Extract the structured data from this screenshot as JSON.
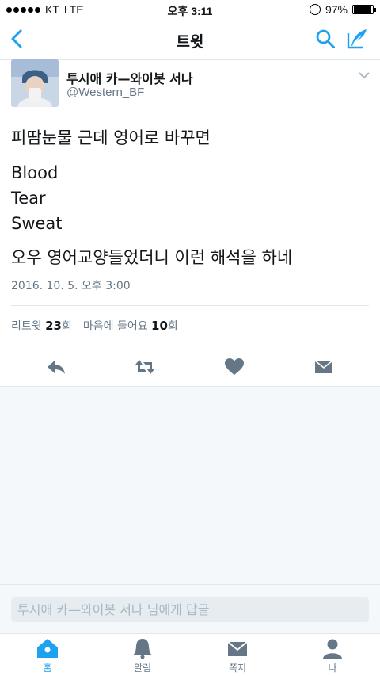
{
  "status_bar": {
    "carrier": "KT",
    "network": "LTE",
    "time": "오후 3:11",
    "battery": "97%",
    "battery_level": 0.97
  },
  "nav": {
    "title": "트윗"
  },
  "tweet": {
    "author_name": "투시애 카—와이봇 서나",
    "handle": "@Western_BF",
    "lines": [
      "피땀눈물 근데 영어로 바꾸면",
      "Blood",
      "Tear",
      "Sweat",
      "오우 영어교양들었더니 이런 해석을 하네"
    ],
    "timestamp": "2016. 10. 5. 오후 3:00",
    "retweets_label": "리트윗",
    "retweets_count": "23",
    "retweets_unit": "회",
    "likes_label": "마음에 들어요",
    "likes_count": "10",
    "likes_unit": "회"
  },
  "reply": {
    "placeholder": "투시애 카—와이봇 서나 님에게 답글"
  },
  "tabs": [
    {
      "label": "홈",
      "icon": "home-icon",
      "active": true
    },
    {
      "label": "알림",
      "icon": "bell-icon",
      "active": false
    },
    {
      "label": "쪽지",
      "icon": "envelope-icon",
      "active": false
    },
    {
      "label": "나",
      "icon": "profile-icon",
      "active": false
    }
  ],
  "colors": {
    "accent": "#1da1f2",
    "icon_gray": "#657786",
    "text": "#14171a",
    "muted": "#657786"
  }
}
